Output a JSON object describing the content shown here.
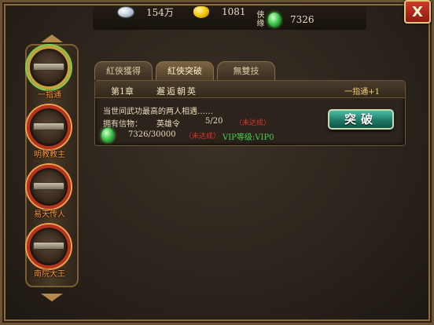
{
  "resources": {
    "silver": {
      "icon": "silver-ingot-icon",
      "value": "154万"
    },
    "gold": {
      "icon": "gold-ingot-icon",
      "value": "1081"
    },
    "jade": {
      "label": "侠缘",
      "icon": "green-jade-icon",
      "value": "7326"
    }
  },
  "close_label": "X",
  "heroes": [
    {
      "name": "一指通",
      "selected": true
    },
    {
      "name": "明教教主",
      "selected": false
    },
    {
      "name": "易天传人",
      "selected": false
    },
    {
      "name": "南院大王",
      "selected": false
    }
  ],
  "tabs": [
    {
      "label": "紅俠獲得",
      "active": false
    },
    {
      "label": "紅俠突破",
      "active": true
    },
    {
      "label": "無雙技",
      "active": false
    }
  ],
  "chapter": {
    "number": "第1章",
    "title": "邂逅朝英",
    "reward": "一指通+1"
  },
  "description": "当世间武功最高的两人相遇……",
  "requirement": {
    "label": "拥有信物：",
    "item": "英雄令",
    "count": "5/20",
    "status": "（未达成）"
  },
  "jade_requirement": {
    "progress": "7326/30000",
    "status": "（未达成）",
    "vip": "VIP等级:VIP0"
  },
  "breakthrough_label": "突破",
  "colors": {
    "accent_red": "#e03428",
    "vip_green": "#43d24a",
    "button_teal": "#1e7a66",
    "hero_name_orange": "#ff9a3c"
  }
}
